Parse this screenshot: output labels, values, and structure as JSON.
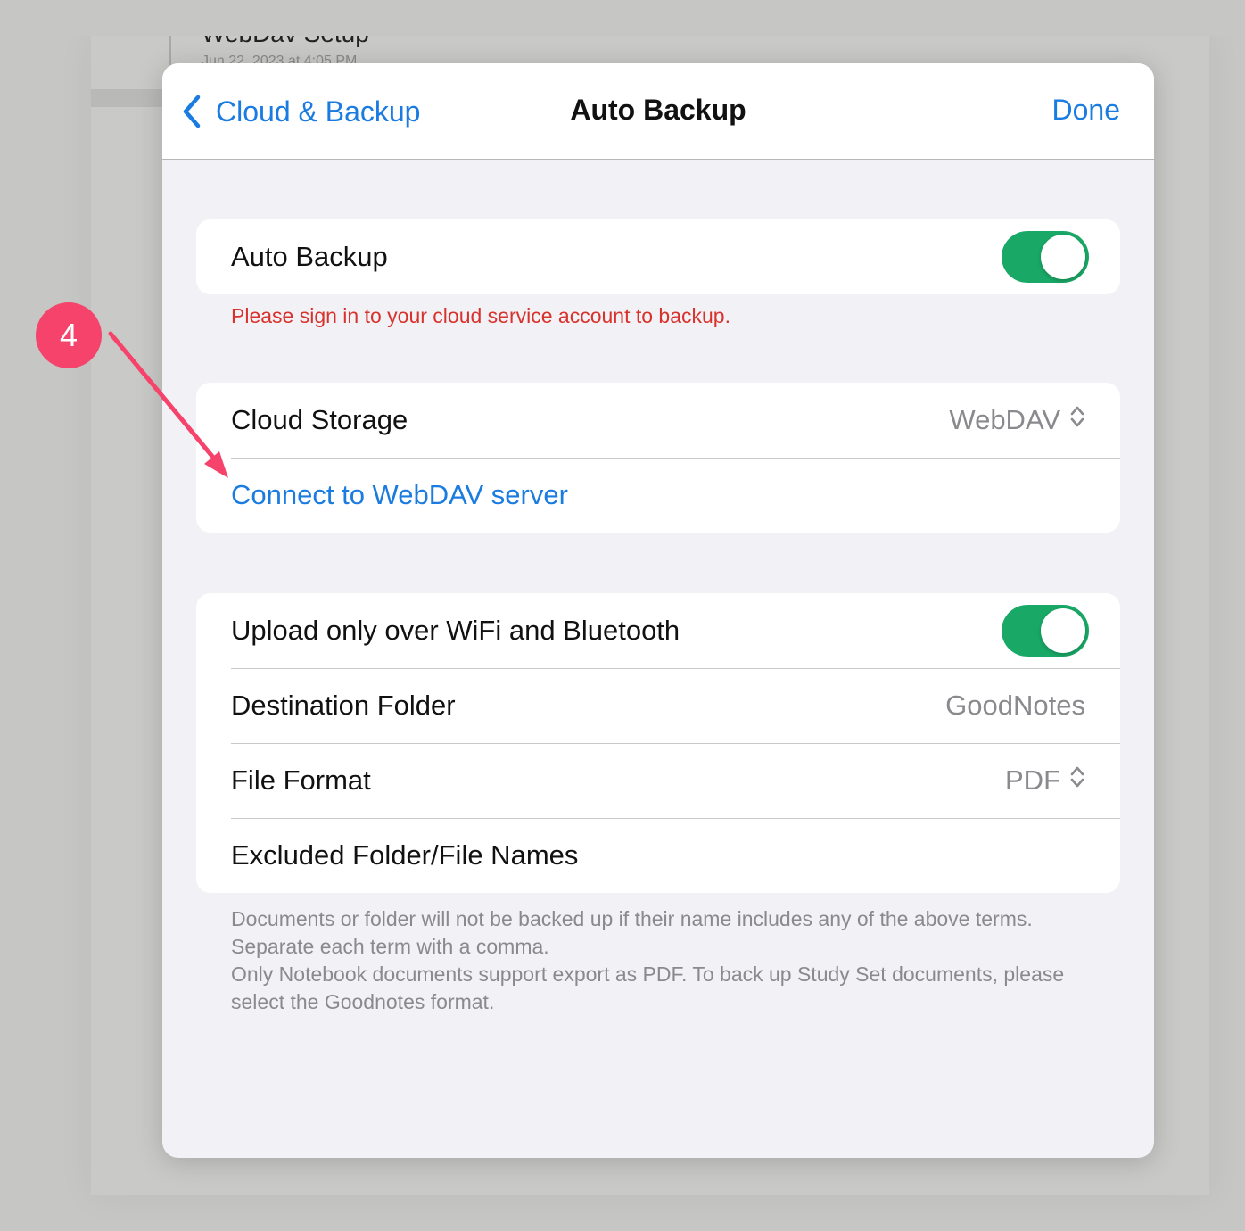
{
  "background": {
    "doc_title": "WebDav Setup",
    "doc_date": "Jun 22, 2023 at 4:05 PM"
  },
  "navbar": {
    "back_label": "Cloud & Backup",
    "title": "Auto Backup",
    "done_label": "Done"
  },
  "auto_backup": {
    "label": "Auto Backup",
    "enabled": true
  },
  "warning": "Please sign in to your cloud service account to backup.",
  "storage": {
    "label": "Cloud Storage",
    "value": "WebDAV",
    "connect_label": "Connect to WebDAV server"
  },
  "settings": {
    "wifi_label": "Upload only over WiFi and Bluetooth",
    "wifi_enabled": true,
    "destination_label": "Destination Folder",
    "destination_value": "GoodNotes",
    "format_label": "File Format",
    "format_value": "PDF",
    "excluded_label": "Excluded Folder/File Names"
  },
  "footnote": {
    "line1": "Documents or folder will not be backed up if their name includes any of the above terms. Separate each term with a comma.",
    "line2": "Only Notebook documents support export as PDF. To back up Study Set documents, please select the Goodnotes format."
  },
  "annotation": {
    "step_number": "4",
    "color": "#f5436b"
  },
  "colors": {
    "accent": "#1a7be0",
    "toggle_on": "#19a866",
    "warning": "#d8322c"
  }
}
